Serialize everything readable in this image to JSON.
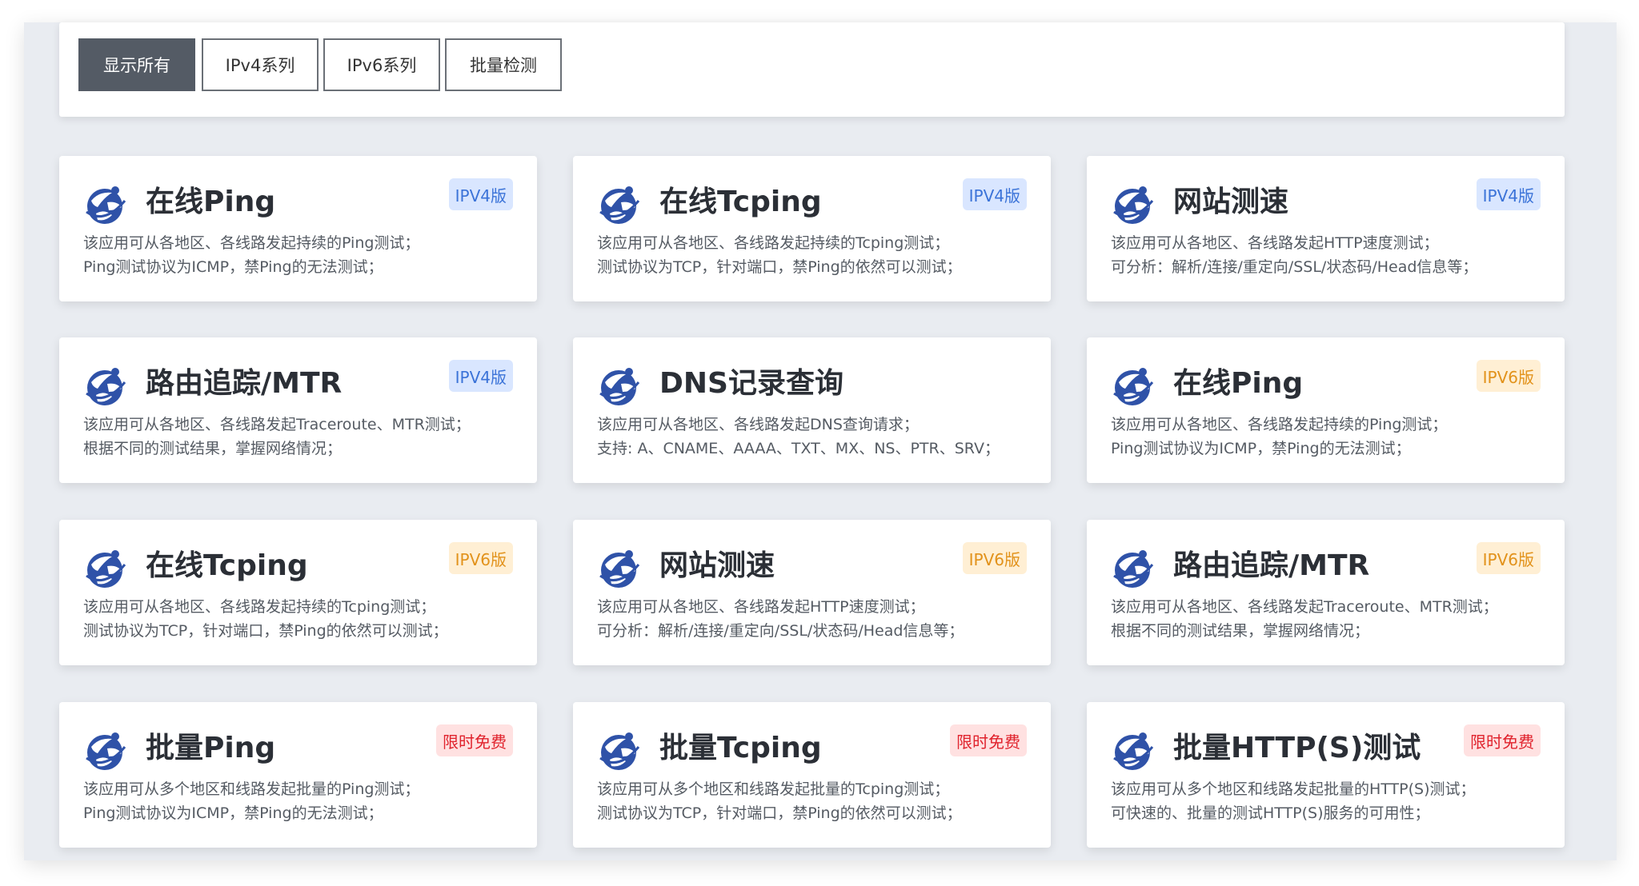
{
  "filters": [
    {
      "label": "显示所有",
      "active": true
    },
    {
      "label": "IPv4系列",
      "active": false
    },
    {
      "label": "IPv6系列",
      "active": false
    },
    {
      "label": "批量检测",
      "active": false
    }
  ],
  "icon": "globe-network-icon",
  "colors": {
    "ipv4": "#3b73d8",
    "ipv6": "#e2921b",
    "free": "#e0232d",
    "logo": "#2f52a8"
  },
  "cards": [
    {
      "title": "在线Ping",
      "badge": "IPV4版",
      "badge_type": "ipv4",
      "line1": "该应用可从各地区、各线路发起持续的Ping测试；",
      "line2": "Ping测试协议为ICMP，禁Ping的无法测试；"
    },
    {
      "title": "在线Tcping",
      "badge": "IPV4版",
      "badge_type": "ipv4",
      "line1": "该应用可从各地区、各线路发起持续的Tcping测试；",
      "line2": "测试协议为TCP，针对端口，禁Ping的依然可以测试；"
    },
    {
      "title": "网站测速",
      "badge": "IPV4版",
      "badge_type": "ipv4",
      "line1": "该应用可从各地区、各线路发起HTTP速度测试；",
      "line2": "可分析：解析/连接/重定向/SSL/状态码/Head信息等；"
    },
    {
      "title": "路由追踪/MTR",
      "badge": "IPV4版",
      "badge_type": "ipv4",
      "line1": "该应用可从各地区、各线路发起Traceroute、MTR测试；",
      "line2": "根据不同的测试结果，掌握网络情况；"
    },
    {
      "title": "DNS记录查询",
      "badge": "",
      "badge_type": "",
      "line1": "该应用可从各地区、各线路发起DNS查询请求；",
      "line2": "支持: A、CNAME、AAAA、TXT、MX、NS、PTR、SRV；"
    },
    {
      "title": "在线Ping",
      "badge": "IPV6版",
      "badge_type": "ipv6",
      "line1": "该应用可从各地区、各线路发起持续的Ping测试；",
      "line2": "Ping测试协议为ICMP，禁Ping的无法测试；"
    },
    {
      "title": "在线Tcping",
      "badge": "IPV6版",
      "badge_type": "ipv6",
      "line1": "该应用可从各地区、各线路发起持续的Tcping测试；",
      "line2": "测试协议为TCP，针对端口，禁Ping的依然可以测试；"
    },
    {
      "title": "网站测速",
      "badge": "IPV6版",
      "badge_type": "ipv6",
      "line1": "该应用可从各地区、各线路发起HTTP速度测试；",
      "line2": "可分析：解析/连接/重定向/SSL/状态码/Head信息等；"
    },
    {
      "title": "路由追踪/MTR",
      "badge": "IPV6版",
      "badge_type": "ipv6",
      "line1": "该应用可从各地区、各线路发起Traceroute、MTR测试；",
      "line2": "根据不同的测试结果，掌握网络情况；"
    },
    {
      "title": "批量Ping",
      "badge": "限时免费",
      "badge_type": "free",
      "line1": "该应用可从多个地区和线路发起批量的Ping测试；",
      "line2": "Ping测试协议为ICMP，禁Ping的无法测试；"
    },
    {
      "title": "批量Tcping",
      "badge": "限时免费",
      "badge_type": "free",
      "line1": "该应用可从多个地区和线路发起批量的Tcping测试；",
      "line2": "测试协议为TCP，针对端口，禁Ping的依然可以测试；"
    },
    {
      "title": "批量HTTP(S)测试",
      "badge": "限时免费",
      "badge_type": "free",
      "line1": "该应用可从多个地区和线路发起批量的HTTP(S)测试；",
      "line2": "可快速的、批量的测试HTTP(S)服务的可用性；"
    }
  ]
}
